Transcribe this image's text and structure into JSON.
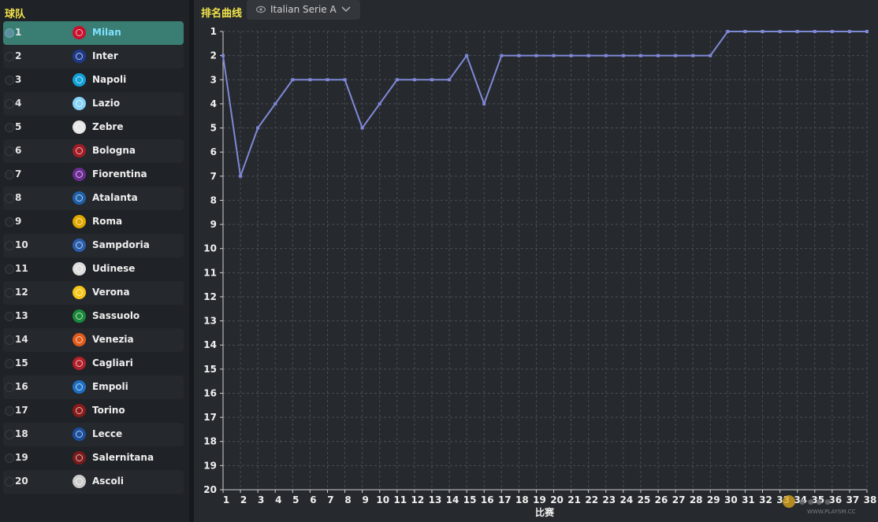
{
  "sidebar": {
    "title": "球队",
    "teams": [
      {
        "pos": "1",
        "name": "Milan",
        "crest": "milan-crest-icon",
        "color": "#c8102e",
        "selected": true
      },
      {
        "pos": "2",
        "name": "Inter",
        "crest": "inter-crest-icon",
        "color": "#1e3a8a"
      },
      {
        "pos": "3",
        "name": "Napoli",
        "crest": "napoli-crest-icon",
        "color": "#12a0d7"
      },
      {
        "pos": "4",
        "name": "Lazio",
        "crest": "lazio-crest-icon",
        "color": "#87d3f8"
      },
      {
        "pos": "5",
        "name": "Zebre",
        "crest": "zebre-crest-icon",
        "color": "#e6e6e6"
      },
      {
        "pos": "6",
        "name": "Bologna",
        "crest": "bologna-crest-icon",
        "color": "#a21c26"
      },
      {
        "pos": "7",
        "name": "Fiorentina",
        "crest": "fiorentina-crest-icon",
        "color": "#6b2c91"
      },
      {
        "pos": "8",
        "name": "Atalanta",
        "crest": "atalanta-crest-icon",
        "color": "#1f5fa8"
      },
      {
        "pos": "9",
        "name": "Roma",
        "crest": "roma-crest-icon",
        "color": "#e0a800"
      },
      {
        "pos": "10",
        "name": "Sampdoria",
        "crest": "sampdoria-crest-icon",
        "color": "#2b5dab"
      },
      {
        "pos": "11",
        "name": "Udinese",
        "crest": "udinese-crest-icon",
        "color": "#dddddd"
      },
      {
        "pos": "12",
        "name": "Verona",
        "crest": "verona-crest-icon",
        "color": "#f5c518"
      },
      {
        "pos": "13",
        "name": "Sassuolo",
        "crest": "sassuolo-crest-icon",
        "color": "#1a8a3a"
      },
      {
        "pos": "14",
        "name": "Venezia",
        "crest": "venezia-crest-icon",
        "color": "#e05a1a"
      },
      {
        "pos": "15",
        "name": "Cagliari",
        "crest": "cagliari-crest-icon",
        "color": "#b0202a"
      },
      {
        "pos": "16",
        "name": "Empoli",
        "crest": "empoli-crest-icon",
        "color": "#1e6fc2"
      },
      {
        "pos": "17",
        "name": "Torino",
        "crest": "torino-crest-icon",
        "color": "#8b1a1a"
      },
      {
        "pos": "18",
        "name": "Lecce",
        "crest": "lecce-crest-icon",
        "color": "#1b4f9c"
      },
      {
        "pos": "19",
        "name": "Salernitana",
        "crest": "salernitana-crest-icon",
        "color": "#7a1a1a"
      },
      {
        "pos": "20",
        "name": "Ascoli",
        "crest": "ascoli-crest-icon",
        "color": "#cccccc"
      }
    ]
  },
  "panel": {
    "title": "排名曲线",
    "league_select": {
      "value": "Italian Serie A",
      "icon": "eye-icon",
      "chevron": "chevron-down-icon"
    }
  },
  "chart_data": {
    "type": "line",
    "title": "",
    "xlabel": "比赛",
    "ylabel": "",
    "x": [
      1,
      2,
      3,
      4,
      5,
      6,
      7,
      8,
      9,
      10,
      11,
      12,
      13,
      14,
      15,
      16,
      17,
      18,
      19,
      20,
      21,
      22,
      23,
      24,
      25,
      26,
      27,
      28,
      29,
      30,
      31,
      32,
      33,
      34,
      35,
      36,
      37,
      38
    ],
    "y_ticks": [
      1,
      2,
      3,
      4,
      5,
      6,
      7,
      8,
      9,
      10,
      11,
      12,
      13,
      14,
      15,
      16,
      17,
      18,
      19,
      20
    ],
    "ylim": [
      1,
      20
    ],
    "y_inverted": true,
    "grid": true,
    "series": [
      {
        "values": [
          2,
          7,
          5,
          4,
          3,
          3,
          3,
          3,
          5,
          4,
          3,
          3,
          3,
          3,
          2,
          4,
          2,
          2,
          2,
          2,
          2,
          2,
          2,
          2,
          2,
          2,
          2,
          2,
          2,
          1,
          1,
          1,
          1,
          1,
          1,
          1,
          1,
          1
        ]
      }
    ],
    "colors": {
      "line": "#7f88d6",
      "grid": "#4a4e54",
      "axis": "#d0d0d0",
      "label": "#f0f0f0"
    }
  },
  "watermark": {
    "text": "WWW.PLAYSM.CC"
  }
}
